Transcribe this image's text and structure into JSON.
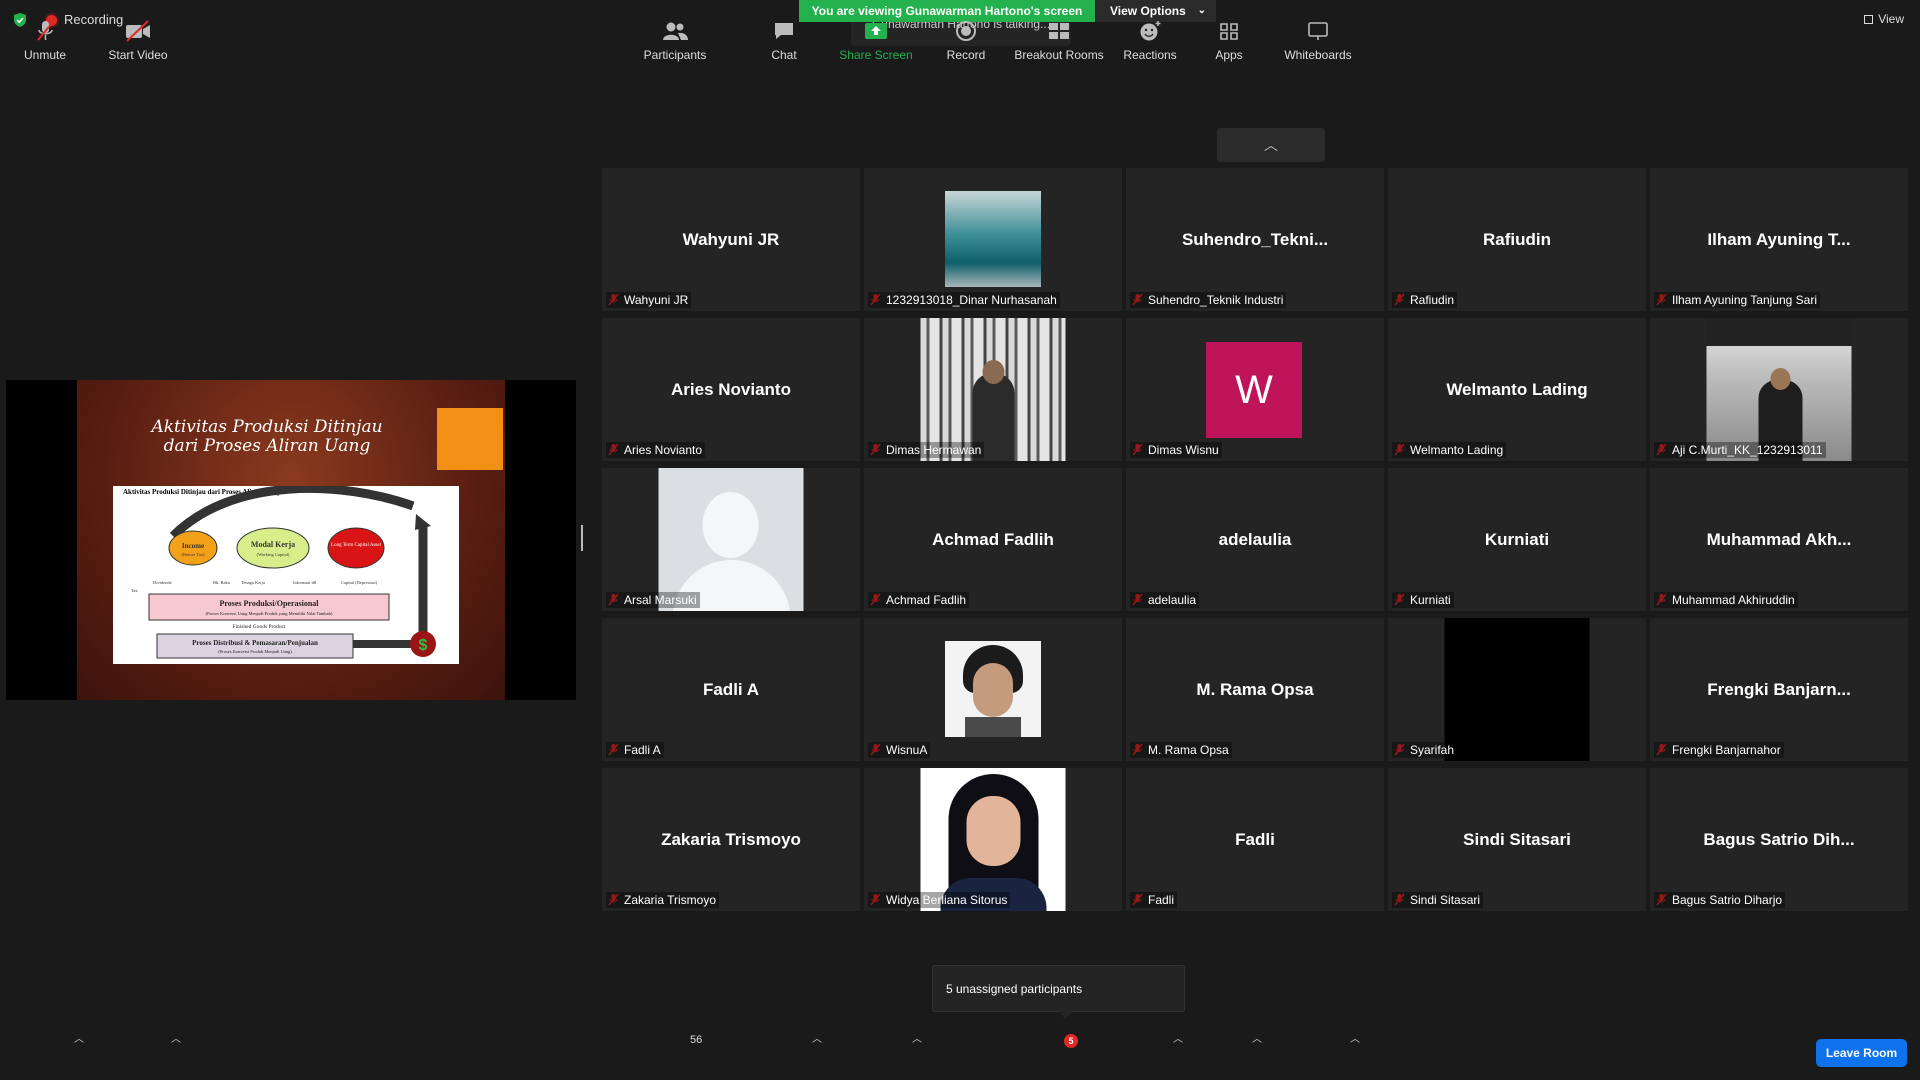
{
  "topbar": {
    "recording_label": "Recording",
    "viewing_banner": "You are viewing Gunawarman Hartono's screen",
    "view_options_label": "View Options",
    "talking_text": "Gunawarman Hartono is talking...",
    "view_label": "View"
  },
  "slide": {
    "title": "Aktivitas Produksi Ditinjau dari Proses Aliran Uang",
    "diagram": {
      "caption": "Aktivitas Produksi Ditinjau dari Proses Aliran Uang",
      "income": "Income",
      "income_sub": "(Before Tax)",
      "modal": "Modal Kerja",
      "modal_sub": "(Working Capital)",
      "longterm": "Long Term Capital Asset",
      "dividends": "Dividends",
      "tax": "Tax",
      "bahan_baku": "Bh. Baku",
      "tenaga_kerja": "Tenaga Kerja",
      "informasi": "Informasi dll",
      "capital": "Capital (Depresiasi)",
      "proses_produksi": "Proses Produksi/Operasional",
      "proses_produksi_sub": "(Proses Konversi Uang Menjadi Produk yang Memiliki Nilai Tambah)",
      "finished": "Finished Goods Product",
      "proses_distribusi": "Proses Distribusi & Pemasaran/Penjualan",
      "proses_distribusi_sub": "(Proses Konversi Produk Menjadi Uang)",
      "dollar": "$"
    }
  },
  "participants": [
    {
      "display": "Wahyuni JR",
      "name": "Wahyuni JR",
      "kind": "text"
    },
    {
      "display": "",
      "name": "1232913018_Dinar Nurhasanah",
      "kind": "bottle"
    },
    {
      "display": "Suhendro_Tekni...",
      "name": "Suhendro_Teknik Industri",
      "kind": "text"
    },
    {
      "display": "Rafiudin",
      "name": "Rafiudin",
      "kind": "text"
    },
    {
      "display": "Ilham Ayuning T...",
      "name": "Ilham Ayuning Tanjung Sari",
      "kind": "text"
    },
    {
      "display": "Aries Novianto",
      "name": "Aries Novianto",
      "kind": "text"
    },
    {
      "display": "",
      "name": "Dimas Hermawan",
      "kind": "forest"
    },
    {
      "display": "W",
      "name": "Dimas Wisnu",
      "kind": "avatar"
    },
    {
      "display": "Welmanto Lading",
      "name": "Welmanto Lading",
      "kind": "text"
    },
    {
      "display": "",
      "name": "Aji C.Murti_KK_1232913011",
      "kind": "shop"
    },
    {
      "display": "",
      "name": "Arsal Marsuki",
      "kind": "default"
    },
    {
      "display": "Achmad Fadlih",
      "name": "Achmad Fadlih",
      "kind": "text"
    },
    {
      "display": "adelaulia",
      "name": "adelaulia",
      "kind": "text"
    },
    {
      "display": "Kurniati",
      "name": "Kurniati",
      "kind": "text"
    },
    {
      "display": "Muhammad  Akh...",
      "name": "Muhammad Akhiruddin",
      "kind": "text"
    },
    {
      "display": "Fadli A",
      "name": "Fadli A",
      "kind": "text"
    },
    {
      "display": "",
      "name": "WisnuA",
      "kind": "face"
    },
    {
      "display": "M. Rama Opsa",
      "name": "M. Rama Opsa",
      "kind": "text"
    },
    {
      "display": "",
      "name": "Syarifah",
      "kind": "black"
    },
    {
      "display": "Frengki  Banjarn...",
      "name": "Frengki Banjarnahor",
      "kind": "text"
    },
    {
      "display": "Zakaria Trismoyo",
      "name": "Zakaria Trismoyo",
      "kind": "text"
    },
    {
      "display": "",
      "name": "Widya Berliana Sitorus",
      "kind": "woman"
    },
    {
      "display": "Fadli",
      "name": "Fadli",
      "kind": "text"
    },
    {
      "display": "Sindi Sitasari",
      "name": "Sindi Sitasari",
      "kind": "text"
    },
    {
      "display": "Bagus Satrio Dih...",
      "name": "Bagus Satrio Diharjo",
      "kind": "text"
    }
  ],
  "tooltip": "5 unassigned participants",
  "toolbar": {
    "unmute": "Unmute",
    "start_video": "Start Video",
    "participants": "Participants",
    "participants_count": "56",
    "chat": "Chat",
    "share_screen": "Share Screen",
    "record": "Record",
    "breakout_rooms": "Breakout Rooms",
    "breakout_badge": "5",
    "reactions": "Reactions",
    "apps": "Apps",
    "whiteboards": "Whiteboards",
    "leave_room": "Leave Room"
  },
  "colors": {
    "share_green": "#23b14d",
    "leave_blue": "#0e72ed",
    "muted_red": "#e02828",
    "avatar_pink": "#c0145a"
  }
}
